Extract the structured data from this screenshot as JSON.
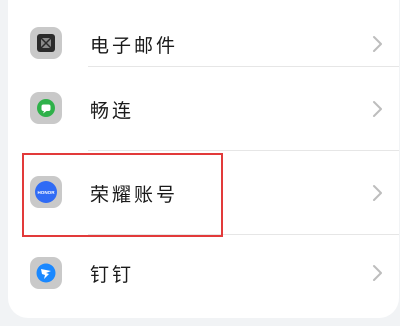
{
  "settings_list": {
    "items": [
      {
        "label": "电子邮件",
        "icon": "email-icon",
        "icon_color": "#333333"
      },
      {
        "label": "畅连",
        "icon": "chat-bubble-icon",
        "icon_color": "#2fb14a"
      },
      {
        "label": "荣耀账号",
        "icon": "honor-logo-icon",
        "icon_color": "#2f6bf5",
        "icon_text": "HONOR"
      },
      {
        "label": "钉钉",
        "icon": "dingtalk-icon",
        "icon_color": "#1a88ff"
      }
    ],
    "highlighted_item": "荣耀账号",
    "highlight_color": "#e23a3a"
  }
}
